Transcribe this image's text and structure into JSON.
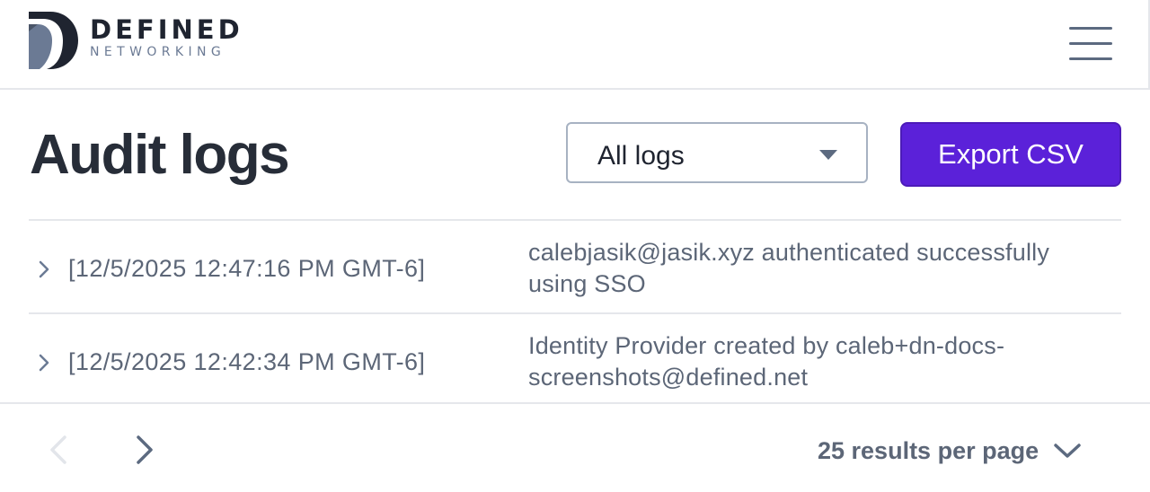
{
  "brand": {
    "name_line1": "DEFINED",
    "name_line2": "NETWORKING"
  },
  "header": {
    "menu_icon": "hamburger-menu-icon"
  },
  "page": {
    "title": "Audit logs"
  },
  "filter": {
    "selected": "All logs",
    "icon": "caret-down-icon"
  },
  "actions": {
    "export_label": "Export CSV"
  },
  "logs": [
    {
      "timestamp": "[12/5/2025 12:47:16 PM GMT-6]",
      "message": "calebjasik@jasik.xyz authenticated successfully using SSO"
    },
    {
      "timestamp": "[12/5/2025 12:42:34 PM GMT-6]",
      "message": "Identity Provider created by caleb+dn-docs-screenshots@defined.net"
    }
  ],
  "pagination": {
    "per_page_label": "25 results per page",
    "prev_enabled": false,
    "next_enabled": true
  },
  "colors": {
    "accent": "#5b21d9",
    "text_muted": "#5c6677",
    "border": "#e5e7eb"
  }
}
